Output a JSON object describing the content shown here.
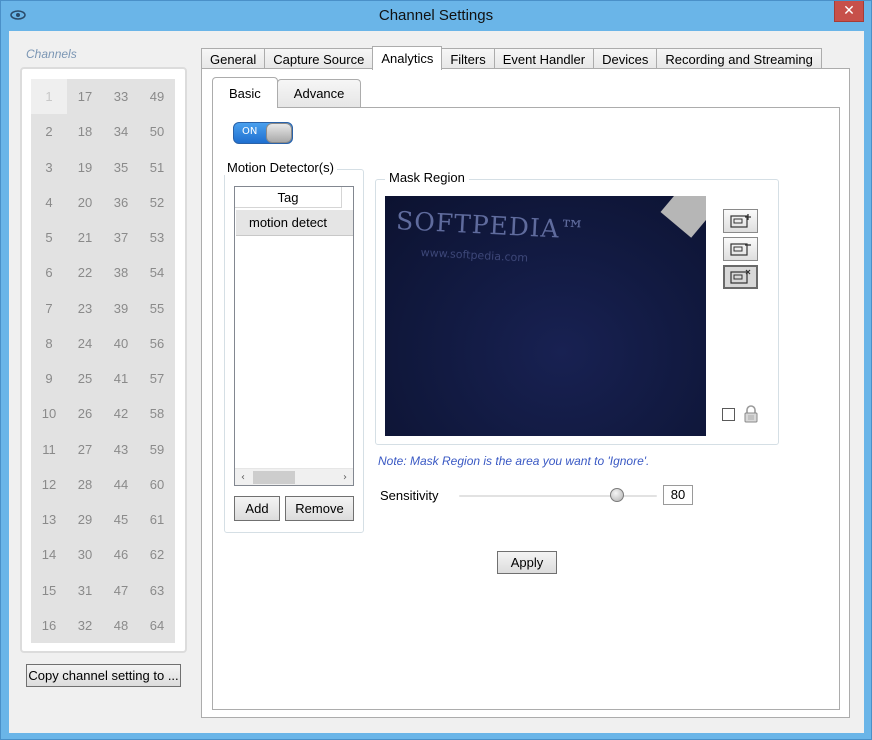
{
  "window": {
    "title": "Channel Settings",
    "close_glyph": "✕"
  },
  "channels": {
    "legend": "Channels",
    "selected": "1",
    "items": [
      "1",
      "17",
      "33",
      "49",
      "2",
      "18",
      "34",
      "50",
      "3",
      "19",
      "35",
      "51",
      "4",
      "20",
      "36",
      "52",
      "5",
      "21",
      "37",
      "53",
      "6",
      "22",
      "38",
      "54",
      "7",
      "23",
      "39",
      "55",
      "8",
      "24",
      "40",
      "56",
      "9",
      "25",
      "41",
      "57",
      "10",
      "26",
      "42",
      "58",
      "11",
      "27",
      "43",
      "59",
      "12",
      "28",
      "44",
      "60",
      "13",
      "29",
      "45",
      "61",
      "14",
      "30",
      "46",
      "62",
      "15",
      "31",
      "47",
      "63",
      "16",
      "32",
      "48",
      "64"
    ],
    "copy_button": "Copy channel setting to ..."
  },
  "tabs": {
    "main": [
      "General",
      "Capture Source",
      "Analytics",
      "Filters",
      "Event Handler",
      "Devices",
      "Recording and Streaming"
    ],
    "active_main": "Analytics",
    "sub": [
      "Basic",
      "Advance"
    ],
    "active_sub": "Basic"
  },
  "analytics": {
    "toggle": {
      "label": "ON",
      "state": "on"
    },
    "motion_detectors": {
      "legend": "Motion Detector(s)",
      "column_header": "Tag",
      "items": [
        "motion detect"
      ],
      "scroll_left": "‹",
      "scroll_right": "›",
      "add_button": "Add",
      "remove_button": "Remove"
    },
    "mask_region": {
      "legend": "Mask Region",
      "preview_watermark": "SOFTPEDIA™",
      "preview_url": "www.softpedia.com",
      "tools": [
        "add-region-icon",
        "remove-region-icon",
        "clear-region-icon"
      ],
      "lock_checked": false,
      "note": "Note: Mask Region is the area you want to 'Ignore'."
    },
    "sensitivity": {
      "label": "Sensitivity",
      "value": "80",
      "fraction": 0.8
    },
    "apply_button": "Apply"
  },
  "colors": {
    "accent": "#6ab5e8",
    "close": "#c7504a",
    "note": "#3a59c4",
    "toggle": "#1f6fd0"
  }
}
